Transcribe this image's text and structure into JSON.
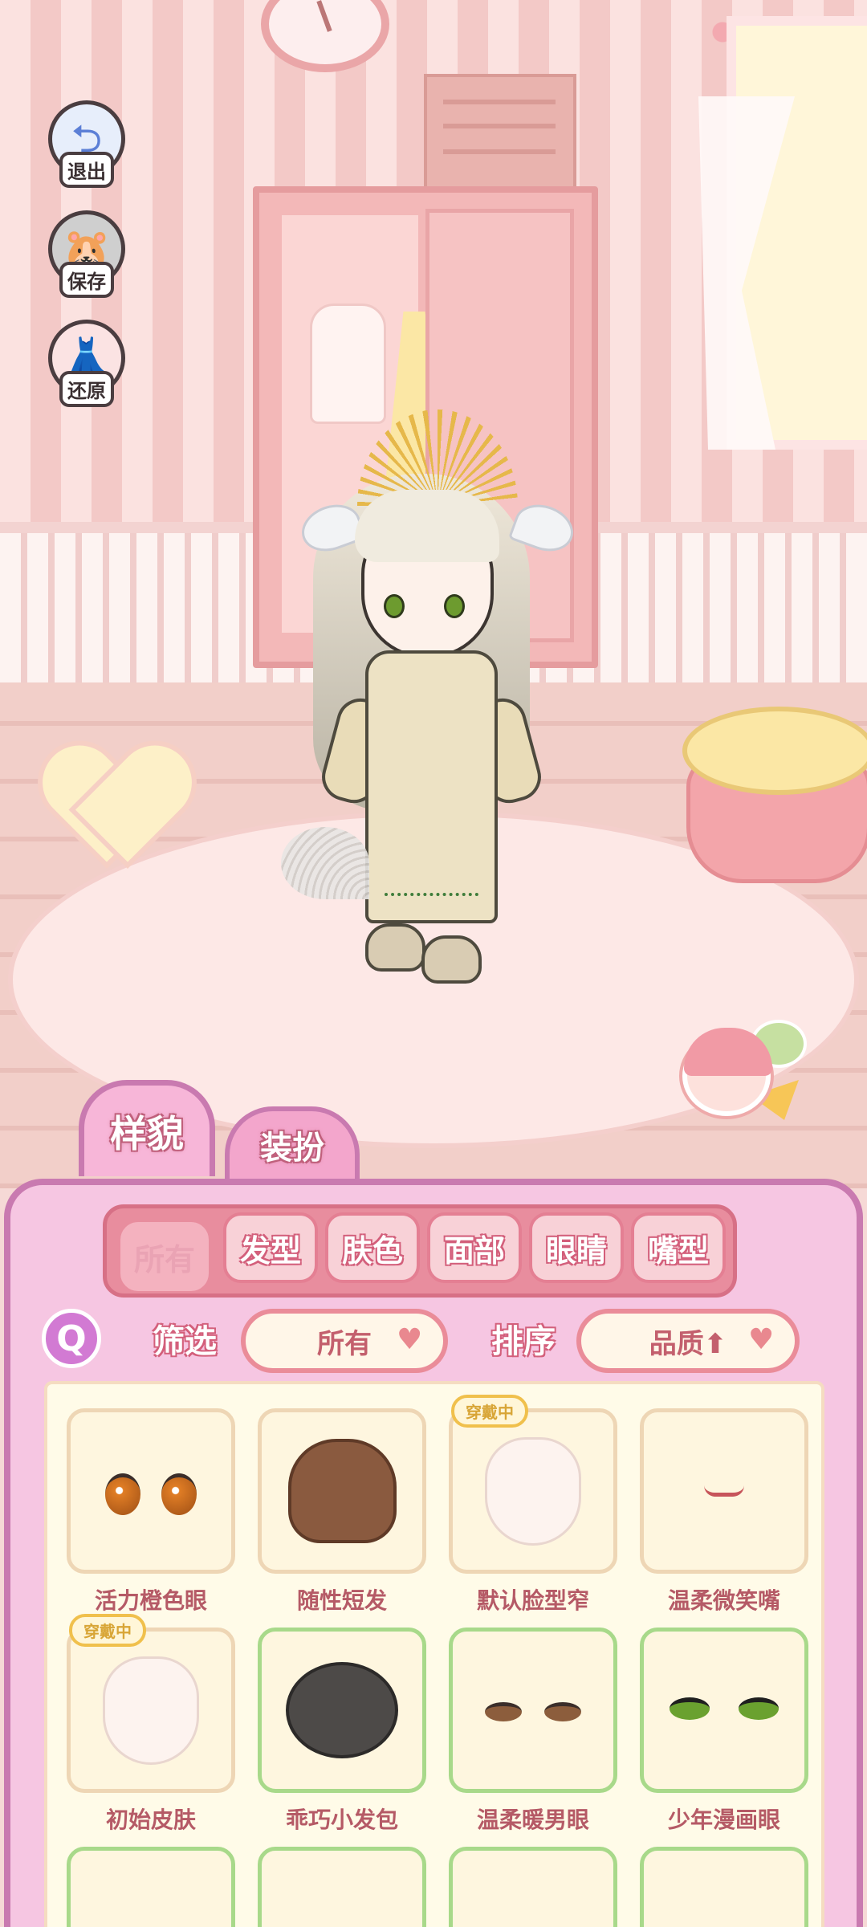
{
  "side_buttons": [
    {
      "label": "退出",
      "icon": "exit-arrow-icon"
    },
    {
      "label": "保存",
      "icon": "save-hamster-icon"
    },
    {
      "label": "还原",
      "icon": "restore-outfit-icon"
    }
  ],
  "main_tabs": {
    "appearance": "样貌",
    "dress_up": "装扮"
  },
  "sub_tabs": [
    "所有",
    "发型",
    "肤色",
    "面部",
    "眼睛",
    "嘴型"
  ],
  "sub_tab_active": "所有",
  "controls": {
    "filter_label": "筛选",
    "filter_value": "所有",
    "sort_label": "排序",
    "sort_value": "品质⬆"
  },
  "items": [
    {
      "name": "活力橙色眼",
      "art": "orange-eyes",
      "wearing": false
    },
    {
      "name": "随性短发",
      "art": "brown-short-hair",
      "wearing": false
    },
    {
      "name": "默认脸型窄",
      "art": "narrow-face",
      "wearing": true,
      "badge": "穿戴中"
    },
    {
      "name": "温柔微笑嘴",
      "art": "smile-mouth",
      "wearing": false
    },
    {
      "name": "初始皮肤",
      "art": "base-skin",
      "wearing": true,
      "badge": "穿戴中"
    },
    {
      "name": "乖巧小发包",
      "art": "bun-hair",
      "wearing": false
    },
    {
      "name": "温柔暖男眼",
      "art": "gentle-eyes",
      "wearing": false
    },
    {
      "name": "少年漫画眼",
      "art": "manga-eyes",
      "wearing": false
    }
  ],
  "colors": {
    "panel": "#f6c6e2",
    "panel_border": "#c97ab0",
    "accent": "#d35f7b",
    "item_text": "#b55a66",
    "wearing_badge": "#f0c04c"
  }
}
